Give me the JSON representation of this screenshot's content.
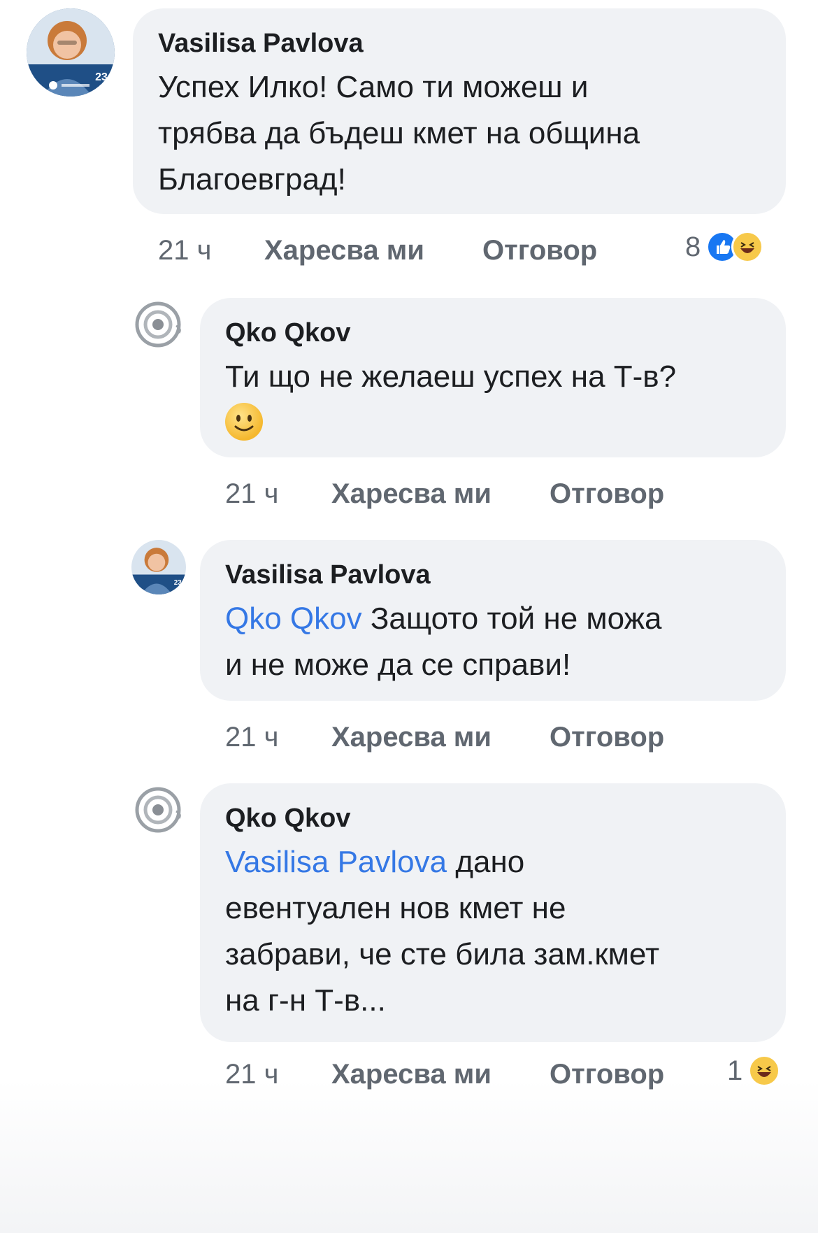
{
  "comments": [
    {
      "author": "Vasilisa Pavlova",
      "text_lines": [
        "Успех Илко!  Само ти можеш и",
        "трябва да бъдеш кмет на община",
        "Благоевград!"
      ],
      "time": "21 ч",
      "like_label": "Харесва ми",
      "reply_label": "Отговор",
      "reactions_count": "8",
      "reaction_icons": [
        "like-icon",
        "haha-icon"
      ]
    },
    {
      "author": "Qko Qkov",
      "text_lines": [
        "Ти що не желаеш успех на Т-в?"
      ],
      "emoji": "smile-emoji-icon",
      "time": "21 ч",
      "like_label": "Харесва ми",
      "reply_label": "Отговор"
    },
    {
      "author": "Vasilisa Pavlova",
      "mention": "Qko Qkov",
      "text_first": " Защото той не можа",
      "text_lines": [
        "и не може да се справи!"
      ],
      "time": "21 ч",
      "like_label": "Харесва ми",
      "reply_label": "Отговор"
    },
    {
      "author": "Qko Qkov",
      "mention": "Vasilisa Pavlova",
      "text_first": " дано",
      "text_lines": [
        "евентуален нов кмет не",
        "забрави, че сте била зам.кмет",
        "на г-н Т-в..."
      ],
      "time": "21 ч",
      "like_label": "Харесва ми",
      "reply_label": "Отговор",
      "reactions_count": "1",
      "reaction_icons": [
        "haha-icon"
      ]
    }
  ],
  "avatar_badge": "23",
  "colors": {
    "bubble": "#f0f2f5",
    "mention": "#3578e5",
    "meta": "#606770",
    "like": "#1877f2",
    "haha": "#f7c94a"
  }
}
